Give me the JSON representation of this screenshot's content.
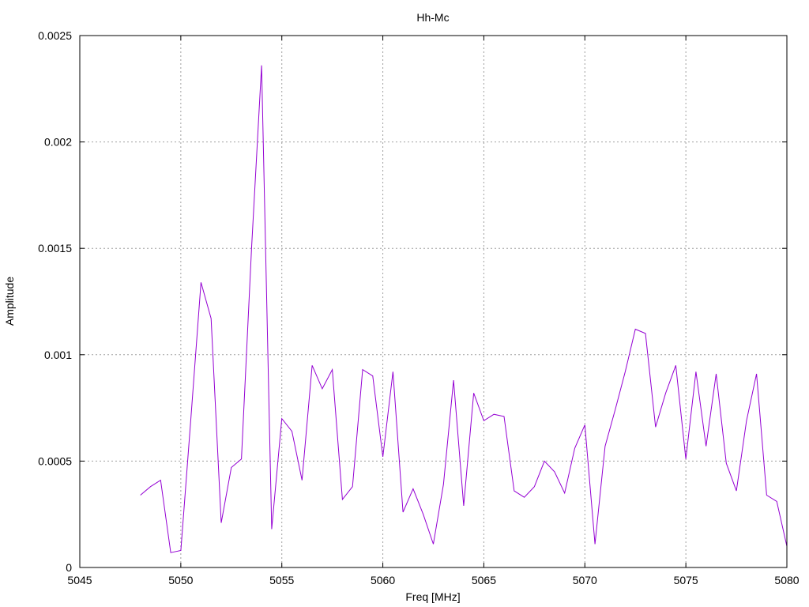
{
  "chart_data": {
    "type": "line",
    "title": "Hh-Mc",
    "xlabel": "Freq [MHz]",
    "ylabel": "Amplitude",
    "xlim": [
      5045,
      5080
    ],
    "ylim": [
      0,
      0.0025
    ],
    "grid": true,
    "x_ticks": [
      "5045",
      "5050",
      "5055",
      "5060",
      "5065",
      "5070",
      "5075",
      "5080"
    ],
    "y_ticks": [
      "0",
      "0.0005",
      "0.001",
      "0.0015",
      "0.002",
      "0.0025"
    ],
    "series": [
      {
        "color": "#9400d3",
        "x": [
          5048,
          5048.5,
          5049,
          5049.5,
          5050,
          5050.5,
          5051,
          5051.5,
          5052,
          5052.5,
          5053,
          5053.5,
          5054,
          5054.5,
          5055,
          5055.5,
          5056,
          5056.5,
          5057,
          5057.5,
          5058,
          5058.5,
          5059,
          5059.5,
          5060,
          5060.5,
          5061,
          5061.5,
          5062,
          5062.5,
          5063,
          5063.5,
          5064,
          5064.5,
          5065,
          5065.5,
          5066,
          5066.5,
          5067,
          5067.5,
          5068,
          5068.5,
          5069,
          5069.5,
          5070,
          5070.5,
          5071,
          5071.5,
          5072,
          5072.5,
          5073,
          5073.5,
          5074,
          5074.5,
          5075,
          5075.5,
          5076,
          5076.5,
          5077,
          5077.5,
          5078,
          5078.5,
          5079,
          5079.5,
          5080
        ],
        "y": [
          0.00034,
          0.00038,
          0.00041,
          7e-05,
          8e-05,
          0.0007,
          0.00134,
          0.00117,
          0.00021,
          0.00047,
          0.00051,
          0.0015,
          0.00236,
          0.00018,
          0.0007,
          0.00064,
          0.00041,
          0.00095,
          0.00084,
          0.00093,
          0.00032,
          0.00038,
          0.00093,
          0.0009,
          0.00052,
          0.00092,
          0.00026,
          0.00037,
          0.00025,
          0.00011,
          0.00039,
          0.00088,
          0.00029,
          0.00082,
          0.00069,
          0.00072,
          0.00071,
          0.00036,
          0.00033,
          0.00038,
          0.0005,
          0.00045,
          0.00035,
          0.00056,
          0.00067,
          0.00011,
          0.00057,
          0.00074,
          0.00092,
          0.00112,
          0.0011,
          0.00066,
          0.00082,
          0.00095,
          0.00051,
          0.00092,
          0.00057,
          0.00091,
          0.00049,
          0.00036,
          0.00069,
          0.00091,
          0.00034,
          0.00031,
          0.0001
        ]
      }
    ]
  }
}
